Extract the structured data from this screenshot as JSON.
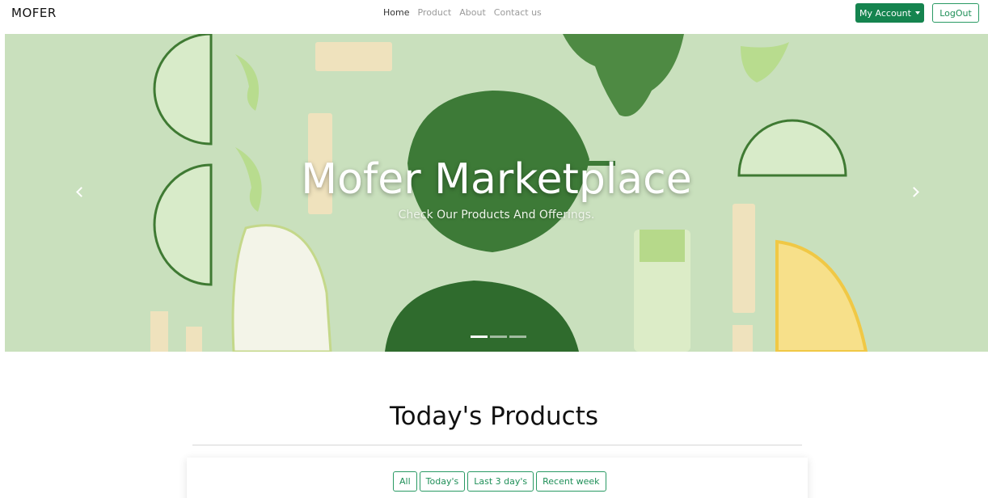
{
  "navbar": {
    "brand": "MOFER",
    "links": [
      {
        "label": "Home",
        "active": true
      },
      {
        "label": "Product",
        "active": false
      },
      {
        "label": "About",
        "active": false
      },
      {
        "label": "Contact us",
        "active": false
      }
    ],
    "account_label": "My Account",
    "logout_label": "LogOut"
  },
  "hero": {
    "title": "Mofer Marketplace",
    "subtitle": "Check Our Products And Offerings.",
    "slide_count": 3,
    "active_slide": 1
  },
  "products": {
    "title": "Today's Products",
    "filters": [
      "All",
      "Today's",
      "Last 3 day's",
      "Recent week"
    ]
  },
  "colors": {
    "accent": "#15844f",
    "hero_bg": "#c9e0bd"
  },
  "icons": {
    "prev": "chevron-left-icon",
    "next": "chevron-right-icon",
    "caret": "caret-down-icon"
  }
}
